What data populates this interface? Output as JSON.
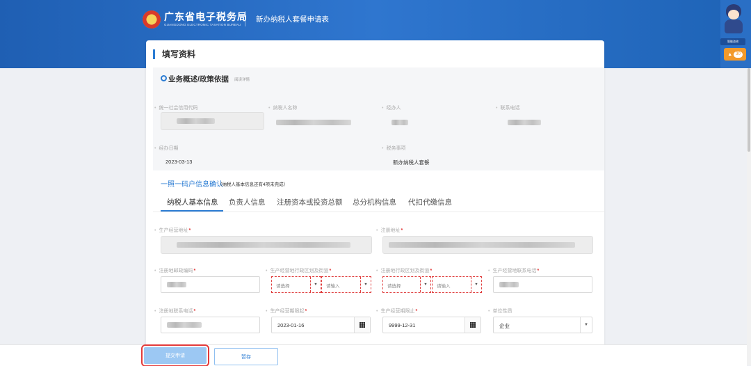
{
  "header": {
    "bureau_name": "广东省电子税务局",
    "bureau_name_en": "GUANGDONG ELECTRONIC TAXATION BUREAU",
    "page_title": "新办纳税人套餐申请表",
    "avatar_tag": "智能咨询",
    "alert_count": "30",
    "colors": {
      "banner": "#2f76cf",
      "alert": "#f39a2b"
    }
  },
  "form": {
    "title": "填写资料",
    "policy": {
      "title": "业务概述/政策依据",
      "link": "阅读详情"
    },
    "basic": {
      "credit_code_label": "统一社会信用代码",
      "taxpayer_name_label": "纳税人名称",
      "handler_label": "经办人",
      "phone_label": "联系电话",
      "handle_date_label": "经办日期",
      "handle_date": "2023-03-13",
      "tax_item_label": "税务事项",
      "tax_item": "新办纳税人套餐"
    },
    "yimacode": {
      "title": "一照一码户信息确认",
      "note": "（纳税人基本信息还有4项未完成）"
    },
    "tabs": [
      {
        "label": "纳税人基本信息"
      },
      {
        "label": "负责人信息"
      },
      {
        "label": "注册资本或投资总额"
      },
      {
        "label": "总分机构信息"
      },
      {
        "label": "代扣代缴信息"
      }
    ],
    "fields": {
      "biz_address_label": "生产经营地址",
      "reg_address_label": "注册地址",
      "reg_postcode_label": "注册地邮政编码",
      "biz_region_label": "生产经营地行政区划及街道",
      "reg_region_label": "注册地行政区划及街道",
      "biz_phone_label": "生产经营地联系电话",
      "select_placeholder": "请选择",
      "input_placeholder": "请输入",
      "reg_phone_label": "注册地联系电话",
      "biz_start_label": "生产经营期限起",
      "biz_start": "2023-01-16",
      "biz_end_label": "生产经营期限止",
      "biz_end": "9999-12-31",
      "unit_type_label": "单位性质",
      "unit_type": "企业",
      "required_mark": "*"
    }
  },
  "footer": {
    "submit_label": "提交申请",
    "save_label": "暂存"
  }
}
